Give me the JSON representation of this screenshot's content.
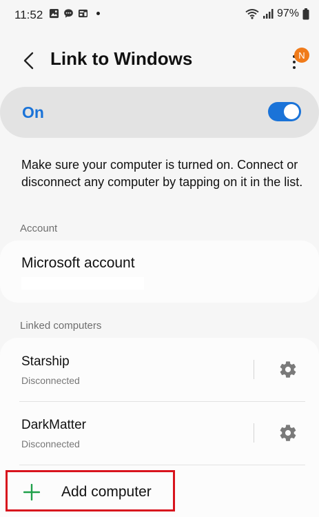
{
  "status_bar": {
    "time": "11:52",
    "battery": "97%",
    "icons": [
      "image-icon",
      "chat-icon",
      "media-icon",
      "notification-dot",
      "wifi-icon",
      "signal-icon",
      "battery-icon"
    ]
  },
  "header": {
    "title": "Link to Windows",
    "badge": "N"
  },
  "master_switch": {
    "label": "On",
    "state": true,
    "accent": "#1a73d8"
  },
  "description": "Make sure your computer is turned on. Connect or disconnect any computer by tapping on it in the list.",
  "account_section": {
    "header": "Account",
    "title": "Microsoft account"
  },
  "linked_section": {
    "header": "Linked computers",
    "computers": [
      {
        "name": "Starship",
        "status": "Disconnected"
      },
      {
        "name": "DarkMatter",
        "status": "Disconnected"
      }
    ],
    "add_label": "Add computer",
    "add_icon_color": "#1fa04a",
    "highlight_color": "#d8141d"
  }
}
